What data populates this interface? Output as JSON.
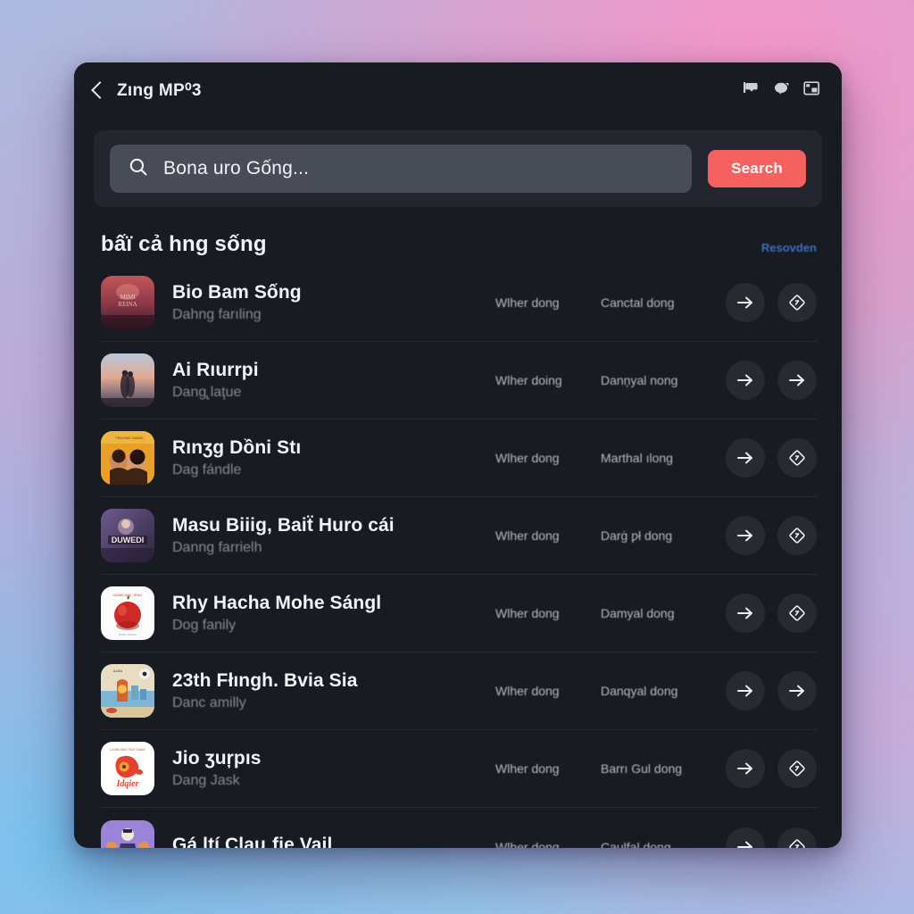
{
  "header": {
    "back_icon": "back-chevron-icon",
    "title": "Zıng MP⁰3",
    "icons": [
      "badge-icon",
      "chat-bubble-icon",
      "picture-in-picture-icon"
    ]
  },
  "search": {
    "icon": "search-icon",
    "value": "Bona uro Gống...",
    "placeholder": "Bona uro Gống...",
    "button_label": "Search",
    "button_color": "#f4615e"
  },
  "section": {
    "title": "bấï cả hng sống",
    "link_label": "Resovden",
    "link_color": "#3c6ebc"
  },
  "rows": [
    {
      "title": "Bio Bam Sống",
      "subtitle": "Dahng farıling",
      "col_a": "Wlher dong",
      "col_b": "Canctal dong",
      "action_1": "arrow-right-icon",
      "action_2": "diamond-badge-icon",
      "thumb": "album-art-red-concert"
    },
    {
      "title": "Ai Rıurrpi",
      "subtitle": "Dang̢ laţue",
      "col_a": "Wlher doing",
      "col_b": "Danņyal nong",
      "action_1": "arrow-right-icon",
      "action_2": "arrow-right-icon",
      "thumb": "album-art-sunset-silhouette"
    },
    {
      "title": "Rınʒg Dồni Stı",
      "subtitle": "Dag fándle",
      "col_a": "Wlher dong",
      "col_b": "Marthal ılong",
      "action_1": "arrow-right-icon",
      "action_2": "diamond-badge-icon",
      "thumb": "album-art-orange-couple"
    },
    {
      "title": "Masu Biiig, Baiẗ Huro cái",
      "subtitle": "Danng farrielh",
      "col_a": "Wlher dong",
      "col_b": "Darġ ƿł dong",
      "action_1": "arrow-right-icon",
      "action_2": "diamond-badge-icon",
      "thumb": "album-art-purple-duwedi"
    },
    {
      "title": "Rhy Hacha Mohe Sángl",
      "subtitle": "Dog fanily",
      "col_a": "Wlher dong",
      "col_b": "Damyal dong",
      "action_1": "arrow-right-icon",
      "action_2": "diamond-badge-icon",
      "thumb": "album-art-red-apple"
    },
    {
      "title": "23th Fłıngh. Bvia Sia",
      "subtitle": "Danc amilly",
      "col_a": "Wlher dong",
      "col_b": "Danqyal dong",
      "action_1": "arrow-right-icon",
      "action_2": "arrow-right-icon",
      "thumb": "album-art-illustration-beach"
    },
    {
      "title": "Jio ʒuŗpıs",
      "subtitle": "Dang Jask",
      "col_a": "Wlher dong",
      "col_b": "Barrı Gul dong",
      "action_1": "arrow-right-icon",
      "action_2": "diamond-badge-icon",
      "thumb": "album-art-white-red-logo"
    },
    {
      "title": "Gá ltí Clauˎfie Vail",
      "subtitle": "",
      "col_a": "Wlher dong",
      "col_b": "Caulfal dong",
      "action_1": "arrow-right-icon",
      "action_2": "diamond-badge-icon",
      "thumb": "album-art-purple-cartoon"
    }
  ]
}
